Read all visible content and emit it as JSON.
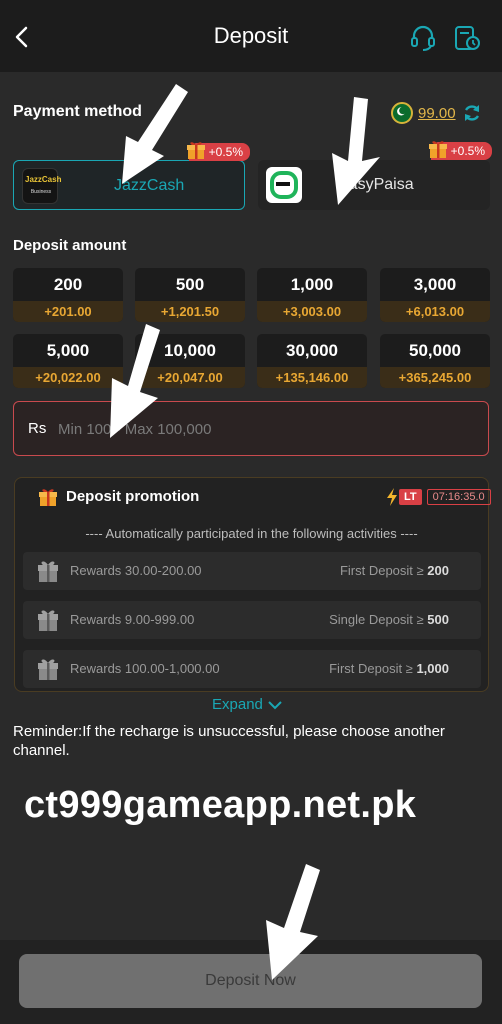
{
  "header": {
    "title": "Deposit"
  },
  "payment": {
    "label": "Payment method",
    "balance": "99.00",
    "methods": [
      {
        "name": "JazzCash",
        "bonus": "+0.5%",
        "logo_text": "JazzCash",
        "logo_sub": "Business"
      },
      {
        "name": "EasyPaisa",
        "bonus": "+0.5%"
      }
    ]
  },
  "deposit": {
    "label": "Deposit amount",
    "amounts": [
      {
        "value": "200",
        "bonus": "+201.00"
      },
      {
        "value": "500",
        "bonus": "+1,201.50"
      },
      {
        "value": "1,000",
        "bonus": "+3,003.00"
      },
      {
        "value": "3,000",
        "bonus": "+6,013.00"
      },
      {
        "value": "5,000",
        "bonus": "+20,022.00"
      },
      {
        "value": "10,000",
        "bonus": "+20,047.00"
      },
      {
        "value": "30,000",
        "bonus": "+135,146.00"
      },
      {
        "value": "50,000",
        "bonus": "+365,245.00"
      }
    ],
    "currency": "Rs",
    "placeholder": "Min 100 - Max 100,000"
  },
  "promotion": {
    "title": "Deposit promotion",
    "badge": "LT",
    "timer": "07:16:35.0",
    "subtitle": "---- Automatically participated in the following activities ----",
    "activities": [
      {
        "reward": "Rewards 30.00-200.00",
        "condition": "First Deposit ≥",
        "threshold": "200"
      },
      {
        "reward": "Rewards 9.00-999.00",
        "condition": "Single Deposit ≥",
        "threshold": "500"
      },
      {
        "reward": "Rewards 100.00-1,000.00",
        "condition": "First Deposit ≥",
        "threshold": "1,000"
      }
    ],
    "expand_label": "Expand"
  },
  "reminder": "Reminder:If the recharge is unsuccessful, please choose another channel.",
  "watermark": "ct999gameapp.net.pk",
  "button": {
    "label": "Deposit Now"
  },
  "colors": {
    "accent": "#1aa7b4",
    "gold": "#e8a733",
    "danger": "#d94045",
    "background": "#2a2a2a"
  },
  "icons": [
    "back-arrow-icon",
    "headset-icon",
    "records-icon",
    "pakistan-flag-icon",
    "refresh-icon",
    "gift-icon",
    "chevron-down-icon",
    "lightning-icon"
  ]
}
